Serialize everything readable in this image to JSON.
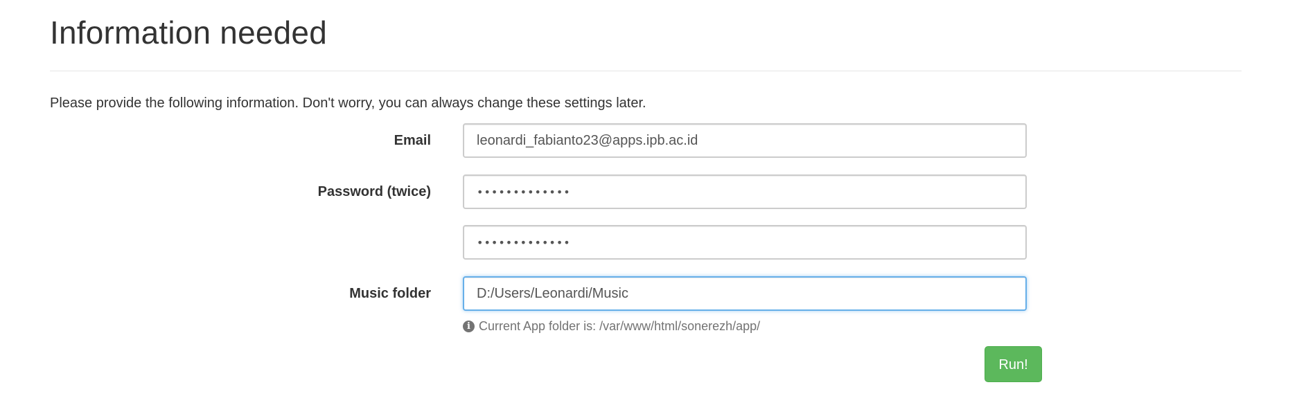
{
  "page": {
    "title": "Information needed",
    "intro": "Please provide the following information. Don't worry, you can always change these settings later."
  },
  "form": {
    "email": {
      "label": "Email",
      "value": "leonardi_fabianto23@apps.ipb.ac.id"
    },
    "password": {
      "label": "Password (twice)",
      "value": "•••••••••••••",
      "confirm_value": "•••••••••••••"
    },
    "music_folder": {
      "label": "Music folder",
      "value": "D:/Users/Leonardi/Music",
      "help_icon": "info-circle-icon",
      "help_text": "Current App folder is: /var/www/html/sonerezh/app/"
    },
    "submit": {
      "label": "Run!",
      "color": "#5cb85c"
    }
  },
  "colors": {
    "focus_border": "#66afe9",
    "input_border": "#cccccc",
    "text": "#333333"
  }
}
